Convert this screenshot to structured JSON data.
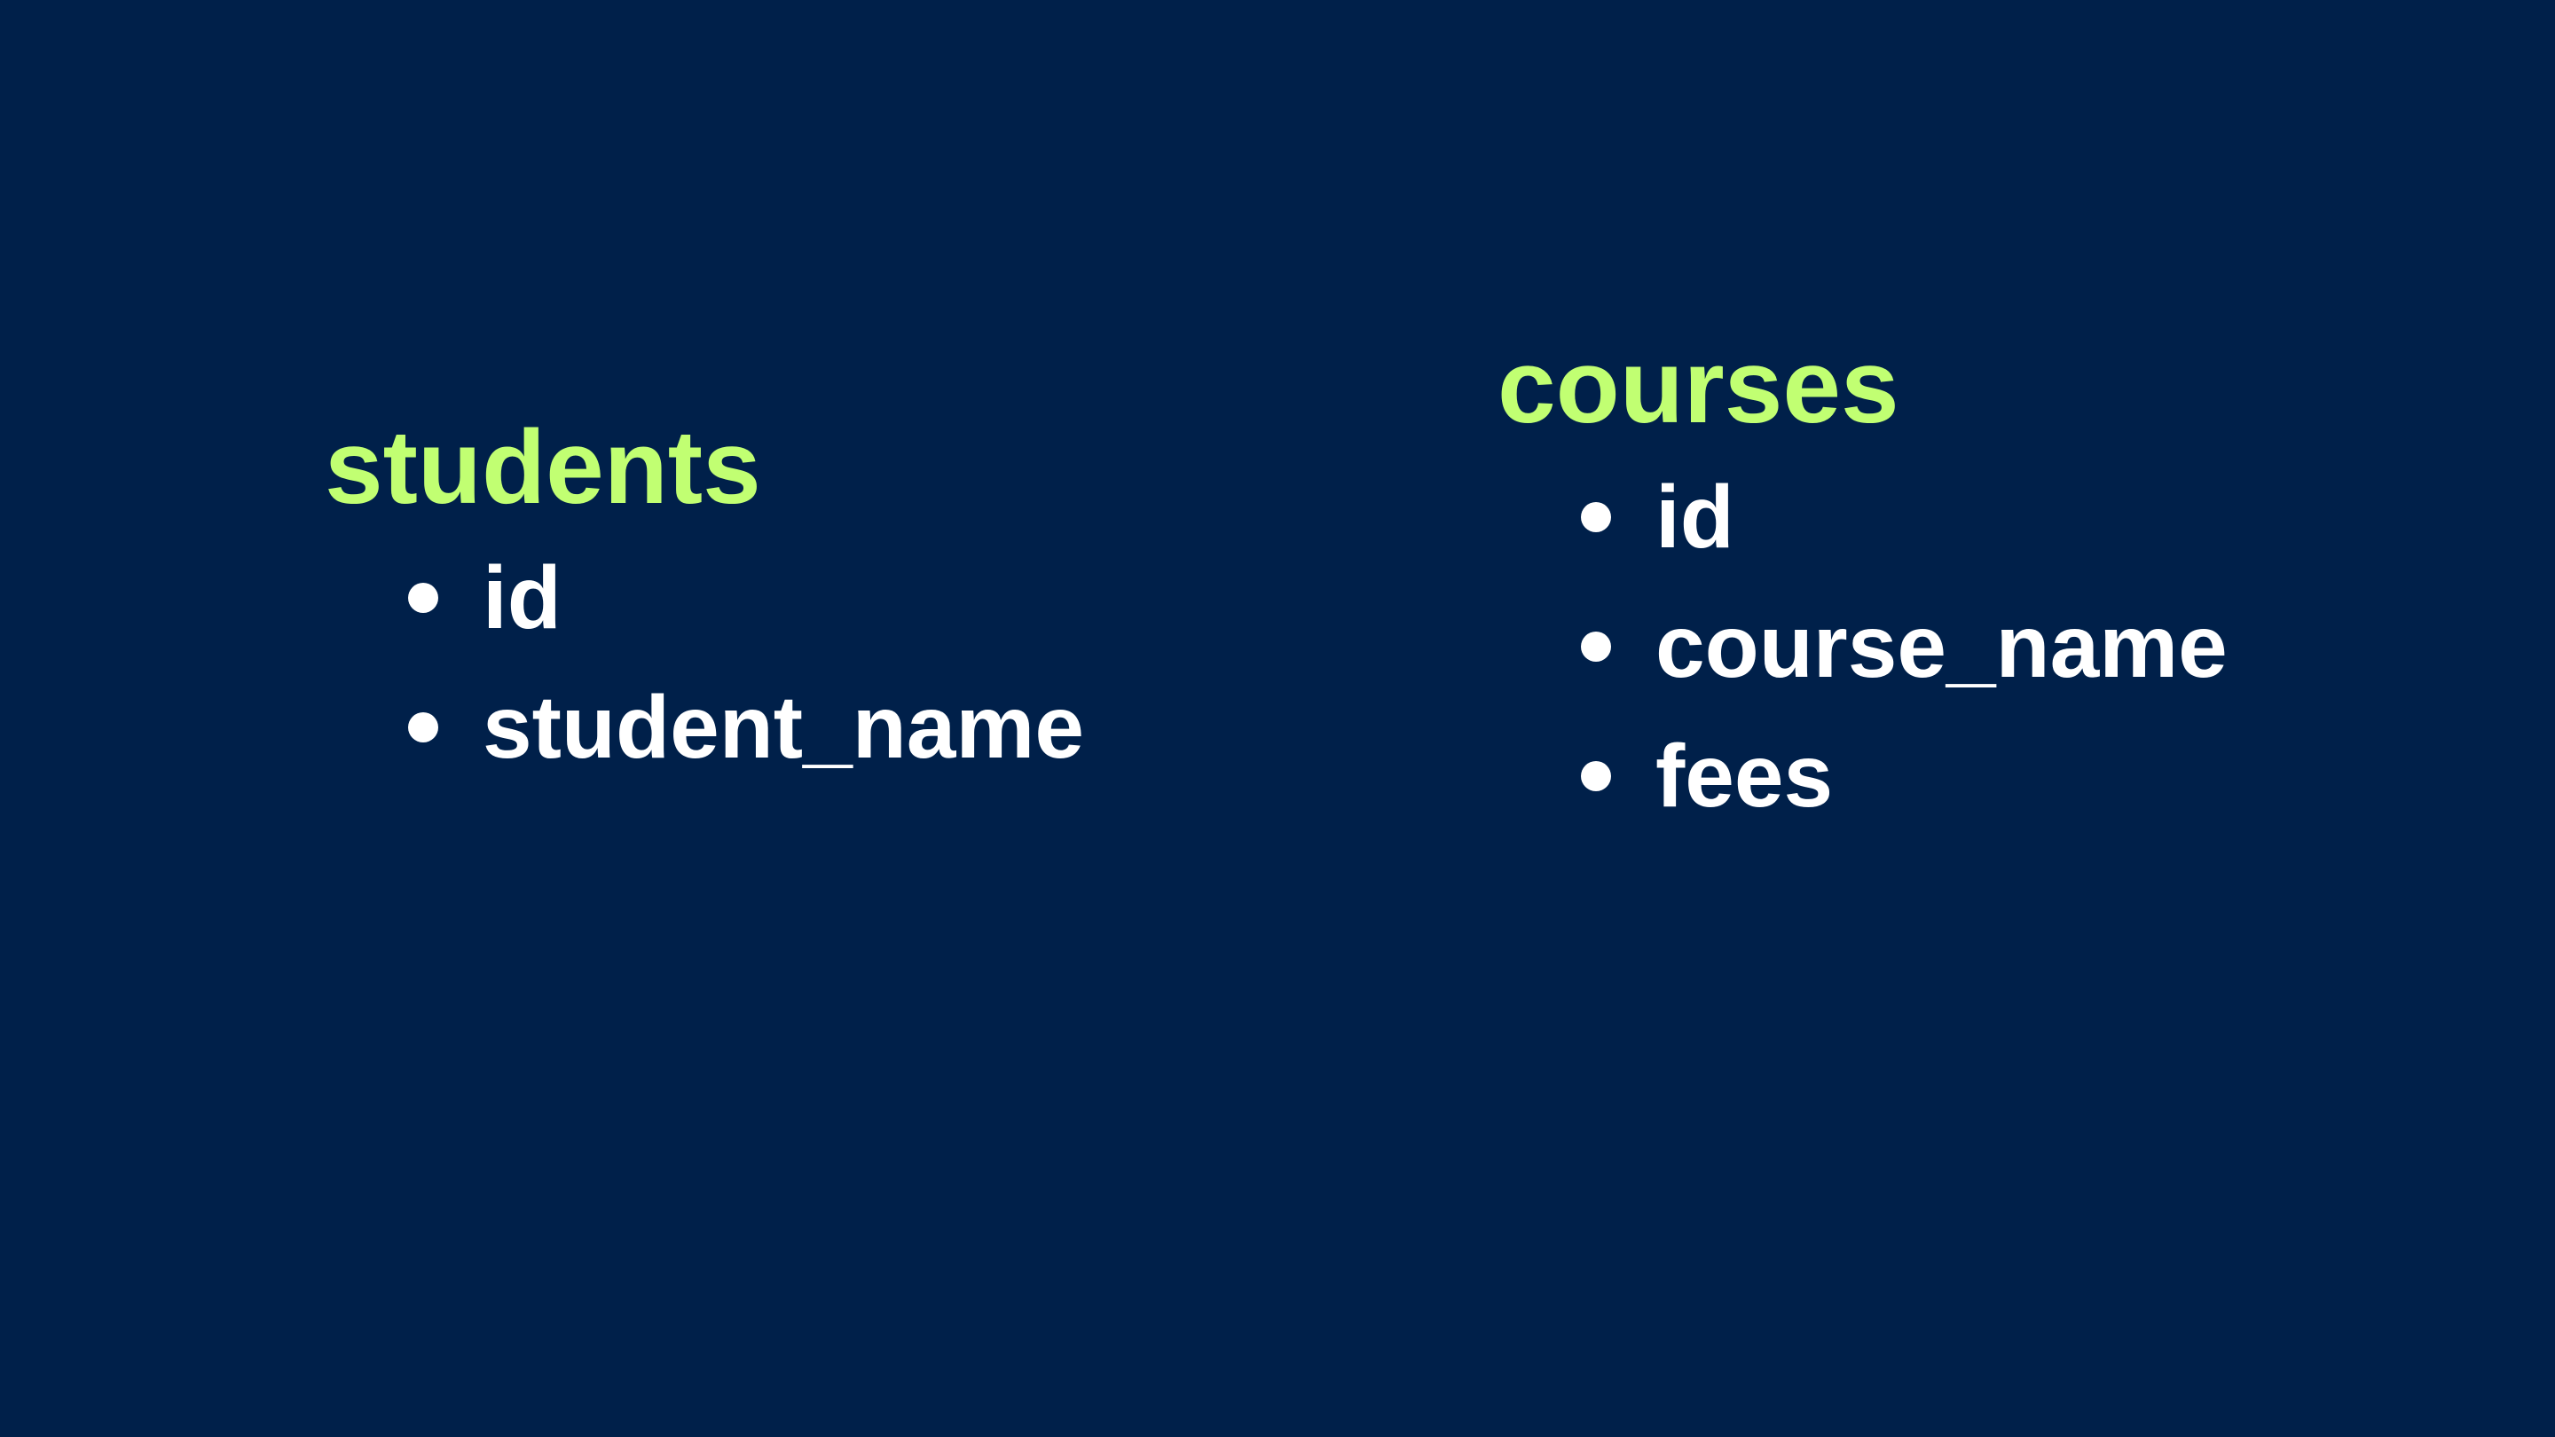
{
  "colors": {
    "background": "#00204a",
    "table_name": "#c1ff72",
    "field_text": "#ffffff"
  },
  "tables": [
    {
      "name": "students",
      "fields": [
        "id",
        "student_name"
      ]
    },
    {
      "name": "courses",
      "fields": [
        "id",
        "course_name",
        "fees"
      ]
    }
  ]
}
